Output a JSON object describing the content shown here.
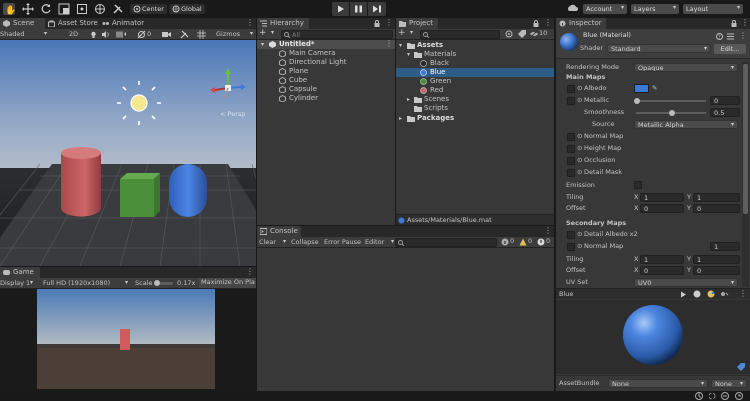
{
  "main_toolbar": {
    "pivot_label": "Center",
    "space_label": "Global",
    "account_label": "Account",
    "layers_label": "Layers",
    "layout_label": "Layout"
  },
  "scene_panel": {
    "tabs": [
      "Scene",
      "Asset Store",
      "Animator"
    ],
    "shading_mode": "Shaded",
    "view_2d": "2D",
    "hidden_count": "0",
    "gizmos_label": "Gizmos",
    "persp_label": "< Persp"
  },
  "game_panel": {
    "tab": "Game",
    "display": "Display 1",
    "resolution": "Full HD (1920x1080)",
    "scale_label": "Scale",
    "scale_value": "0.17x",
    "maximize_label": "Maximize On Pla"
  },
  "hierarchy": {
    "tab": "Hierarchy",
    "search_placeholder": "All",
    "scene_name": "Untitled*",
    "items": [
      "Main Camera",
      "Directional Light",
      "Plane",
      "Cube",
      "Capsule",
      "Cylinder"
    ]
  },
  "project": {
    "tab": "Project",
    "badge_count": "10",
    "assets_label": "Assets",
    "materials_label": "Materials",
    "materials": [
      "Black",
      "Blue",
      "Green",
      "Red"
    ],
    "scenes_label": "Scenes",
    "scripts_label": "Scripts",
    "packages_label": "Packages",
    "path": "Assets/Materials/Blue.mat"
  },
  "console": {
    "tab": "Console",
    "clear_label": "Clear",
    "collapse_label": "Collapse",
    "error_pause_label": "Error Pause",
    "editor_label": "Editor",
    "log_count": "0",
    "warn_count": "0",
    "error_count": "0"
  },
  "inspector": {
    "tab": "Inspector",
    "material_name": "Blue (Material)",
    "shader_label": "Shader",
    "shader_value": "Standard",
    "edit_label": "Edit...",
    "rendering_mode_label": "Rendering Mode",
    "rendering_mode_value": "Opaque",
    "main_maps_label": "Main Maps",
    "albedo_label": "Albedo",
    "metallic_label": "Metallic",
    "metallic_value": "0",
    "smoothness_label": "Smoothness",
    "smoothness_value": "0.5",
    "source_label": "Source",
    "source_value": "Metallic Alpha",
    "normal_map_label": "Normal Map",
    "height_map_label": "Height Map",
    "occlusion_label": "Occlusion",
    "detail_mask_label": "Detail Mask",
    "emission_label": "Emission",
    "tiling_label": "Tiling",
    "offset_label": "Offset",
    "x_label": "X",
    "y_label": "Y",
    "tiling_x": "1",
    "tiling_y": "1",
    "offset_x": "0",
    "offset_y": "0",
    "secondary_maps_label": "Secondary Maps",
    "detail_albedo_label": "Detail Albedo x2",
    "normal_map2_label": "Normal Map",
    "normal_map2_value": "1",
    "tiling2_x": "1",
    "tiling2_y": "1",
    "offset2_x": "0",
    "offset2_y": "0",
    "uv_set_label": "UV Set",
    "uv_set_value": "UV0",
    "preview_name": "Blue",
    "asset_bundle_label": "AssetBundle",
    "asset_bundle_value": "None",
    "asset_bundle_variant": "None",
    "albedo_color": "#3b78d8",
    "accent_color": "#2c5d87"
  }
}
